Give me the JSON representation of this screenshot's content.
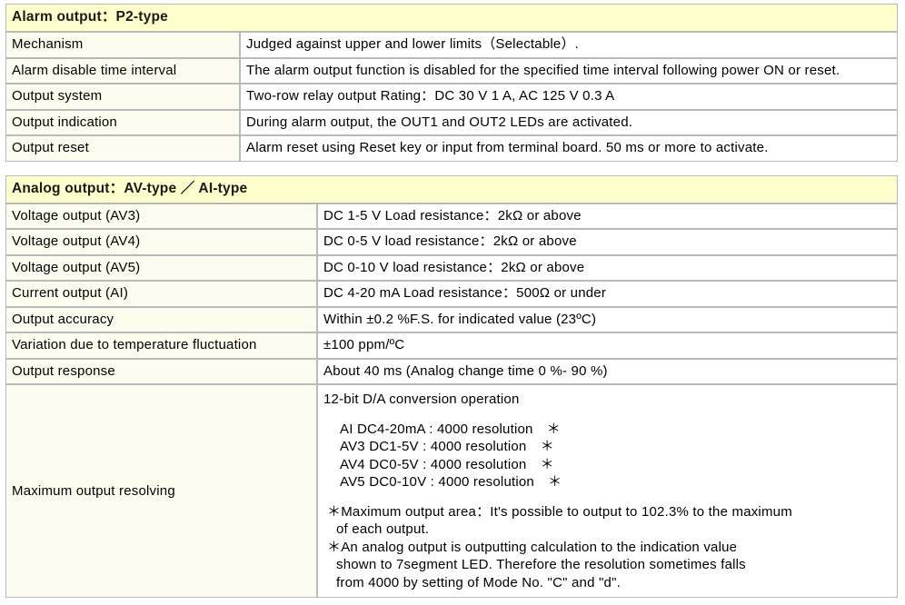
{
  "tables": [
    {
      "id": "alarm-output",
      "header": "Alarm output：P2-type",
      "col_label_width": "258px",
      "rows": [
        {
          "label": "Mechanism",
          "value": "Judged against upper and lower limits（Selectable）."
        },
        {
          "label": "Alarm disable time interval",
          "value": "The alarm output function is disabled for the specified time interval following power ON or reset."
        },
        {
          "label": "Output system",
          "value": "Two-row relay output Rating：DC 30 V 1 A, AC 125 V 0.3 A"
        },
        {
          "label": "Output indication",
          "value": "During alarm output, the OUT1 and OUT2 LEDs are activated."
        },
        {
          "label": "Output reset",
          "value": "Alarm reset using Reset key or input from terminal board. 50 ms or more to activate."
        }
      ]
    },
    {
      "id": "analog-output",
      "header": "Analog output：AV-type ／ AI-type",
      "col_label_width": "343px",
      "rows": [
        {
          "label": "Voltage output (AV3)",
          "value": "DC 1-5 V Load resistance：2kΩ or above"
        },
        {
          "label": "Voltage output (AV4)",
          "value": "DC 0-5 V load resistance：2kΩ or above"
        },
        {
          "label": "Voltage output (AV5)",
          "value": "DC 0-10 V load resistance：2kΩ or above"
        },
        {
          "label": "Current output (AI)",
          "value": "DC 4-20 mA Load resistance：500Ω or under"
        },
        {
          "label": "Output accuracy",
          "value": "Within ±0.2 %F.S. for indicated value (23ºC)"
        },
        {
          "label": "Variation due to temperature fluctuation",
          "value": "±100 ppm/ºC"
        },
        {
          "label": "Output response",
          "value": "About 40 ms (Analog change time 0 %- 90 %)"
        }
      ],
      "resolving_row": {
        "label": "Maximum output resolving",
        "intro": "12-bit D/A conversion operation",
        "resolution_items": [
          "AI DC4-20mA : 4000 resolution　＊",
          "AV3 DC1-5V : 4000 resolution　＊",
          "AV4 DC0-5V : 4000 resolution　＊",
          "AV5 DC0-10V : 4000 resolution　＊"
        ],
        "notes": [
          {
            "first": "＊Maximum output area：It's possible to output to 102.3% to the maximum",
            "rest": "of each output."
          },
          {
            "first": "＊An analog output is outputting calculation to the indication value",
            "rest": "shown to 7segment LED. Therefore the resolution sometimes falls\nfrom 4000 by setting of Mode No. \"C\" and \"d\"."
          }
        ]
      }
    }
  ],
  "colors": {
    "header_bg": "#ffffcc",
    "label_bg": "#fdfdef",
    "value_bg": "#ffffff",
    "border": "#b9b9b9",
    "text": "#000000"
  }
}
